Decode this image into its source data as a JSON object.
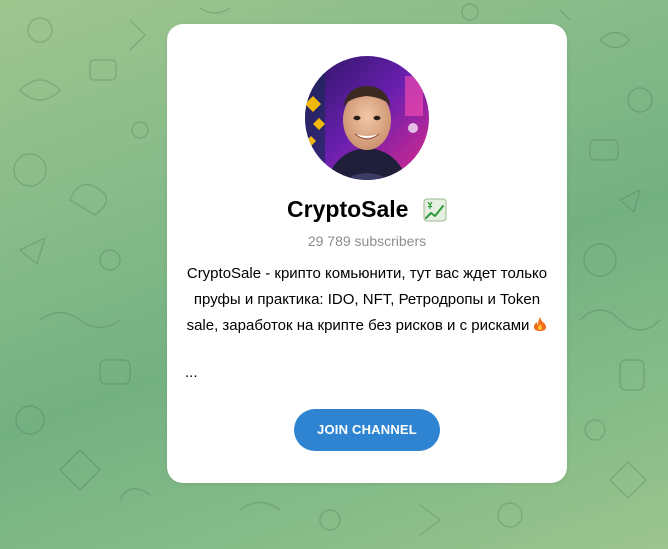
{
  "channel": {
    "name": "CryptoSale",
    "badge_icon": "chart-increasing-yen-emoji",
    "subscribers": "29 789 subscribers",
    "description": "CryptoSale - крипто комьюнити, тут вас ждет только пруфы и практика: IDO, NFT, Ретродропы и Token sale, заработок на крипте без рисков и с рисками",
    "description_icon": "fire-emoji",
    "ellipsis": "...",
    "avatar": "channel-avatar"
  },
  "join_button": {
    "label": "JOIN CHANNEL",
    "color": "#2f84d1"
  },
  "colors": {
    "background_top": "#9fc58e",
    "background_mid": "#74b182",
    "card": "#ffffff",
    "subtitle": "#8d8d8d"
  }
}
